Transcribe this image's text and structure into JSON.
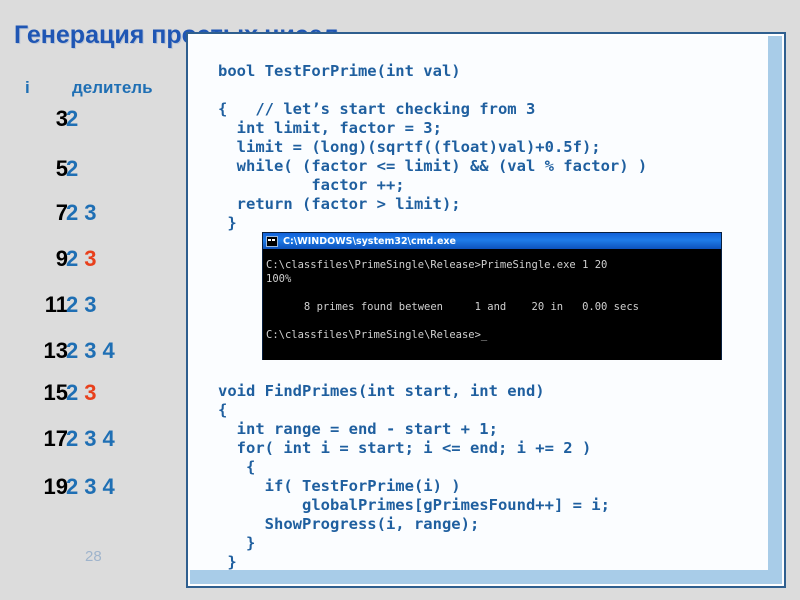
{
  "slide": {
    "title": "Генерация простых чисел",
    "number": "28"
  },
  "table": {
    "headers": {
      "i": "i",
      "divisor": "делитель"
    },
    "rows": [
      {
        "i": "3",
        "divisors": [
          {
            "v": "2",
            "color": "blue"
          }
        ]
      },
      {
        "i": "5",
        "divisors": [
          {
            "v": "2",
            "color": "blue"
          }
        ]
      },
      {
        "i": "7",
        "divisors": [
          {
            "v": "2",
            "color": "blue"
          },
          {
            "v": "3",
            "color": "blue"
          }
        ]
      },
      {
        "i": "9",
        "divisors": [
          {
            "v": "2",
            "color": "blue"
          },
          {
            "v": "3",
            "color": "red"
          }
        ]
      },
      {
        "i": "11",
        "divisors": [
          {
            "v": "2",
            "color": "blue"
          },
          {
            "v": "3",
            "color": "blue"
          }
        ]
      },
      {
        "i": "13",
        "divisors": [
          {
            "v": "2",
            "color": "blue"
          },
          {
            "v": "3",
            "color": "blue"
          },
          {
            "v": "4",
            "color": "blue"
          }
        ]
      },
      {
        "i": "15",
        "divisors": [
          {
            "v": "2",
            "color": "blue"
          },
          {
            "v": "3",
            "color": "red"
          }
        ]
      },
      {
        "i": "17",
        "divisors": [
          {
            "v": "2",
            "color": "blue"
          },
          {
            "v": "3",
            "color": "blue"
          },
          {
            "v": "4",
            "color": "blue"
          }
        ]
      },
      {
        "i": "19",
        "divisors": [
          {
            "v": "2",
            "color": "blue"
          },
          {
            "v": "3",
            "color": "blue"
          },
          {
            "v": "4",
            "color": "blue"
          }
        ]
      }
    ]
  },
  "code": {
    "top": "bool TestForPrime(int val)\n\n{   // let’s start checking from 3\n  int limit, factor = 3;\n  limit = (long)(sqrtf((float)val)+0.5f);\n  while( (factor <= limit) && (val % factor) )\n          factor ++;\n  return (factor > limit);\n }",
    "bottom": "void FindPrimes(int start, int end)\n{\n  int range = end - start + 1;\n  for( int i = start; i <= end; i += 2 )\n   {\n     if( TestForPrime(i) )\n         globalPrimes[gPrimesFound++] = i;\n     ShowProgress(i, range);\n   }\n }"
  },
  "cmd": {
    "title": "C:\\WINDOWS\\system32\\cmd.exe",
    "lines": [
      "C:\\classfiles\\PrimeSingle\\Release>PrimeSingle.exe 1 20",
      "100%",
      "",
      "      8 primes found between     1 and    20 in   0.00 secs",
      "",
      "C:\\classfiles\\PrimeSingle\\Release>_"
    ]
  },
  "colors": {
    "title": "#1f56b4",
    "code_text": "#1f5f9f",
    "divisor_blue": "#1f6fb4",
    "divisor_red": "#e8401c",
    "panel_border": "#2f5f8f",
    "scrollbar": "#a8cce8",
    "background": "#dcdcdc"
  }
}
